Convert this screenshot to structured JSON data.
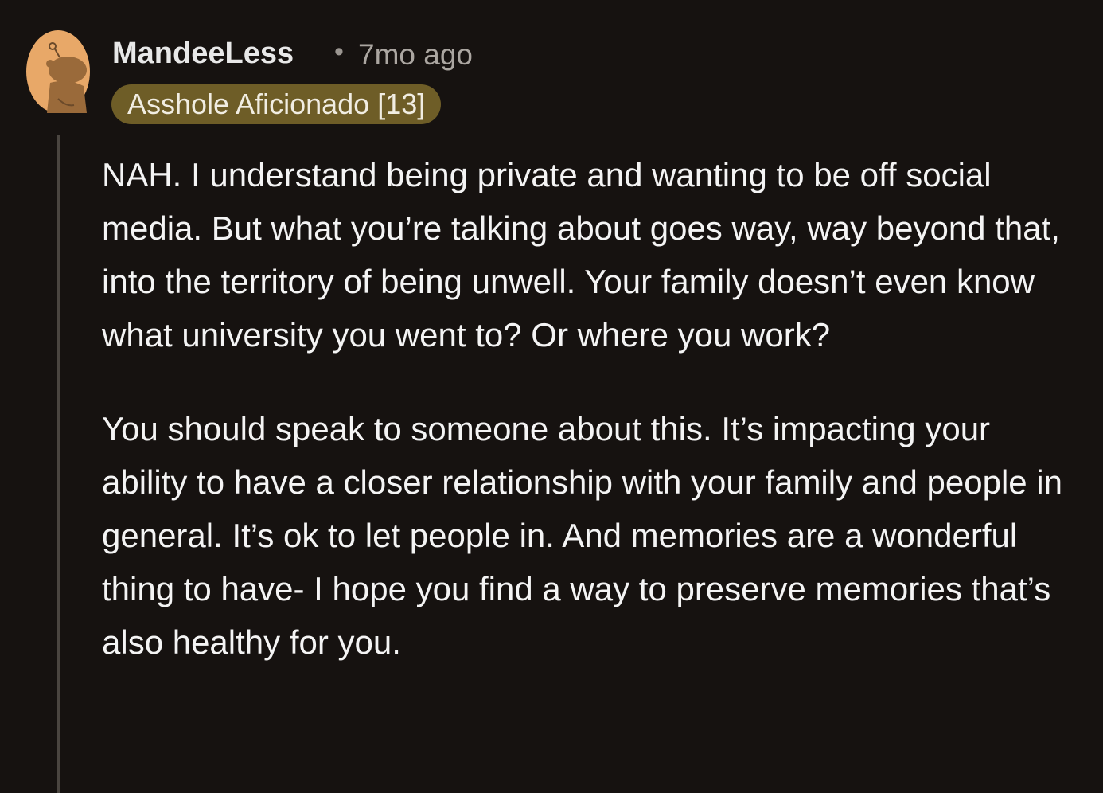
{
  "comment": {
    "username": "MandeeLess",
    "separator": "•",
    "timestamp": "7mo ago",
    "flair": "Asshole Aficionado [13]",
    "avatar_icon": "snoo-avatar-icon",
    "colors": {
      "background": "#161210",
      "flair_bg": "#6e5d27",
      "avatar": "#e8a868"
    },
    "paragraphs": [
      "NAH. I understand being private and wanting to be off social media. But what you’re talking about goes way, way beyond that, into the territory of being unwell. Your family doesn’t even know what university you went to? Or where you work?",
      "You should speak to someone about this. It’s impacting your ability to have a closer relationship with your family and people in general. It’s ok to let people in. And memories are a wonderful thing to have- I hope you find a way to preserve memories that’s also healthy for you."
    ]
  }
}
